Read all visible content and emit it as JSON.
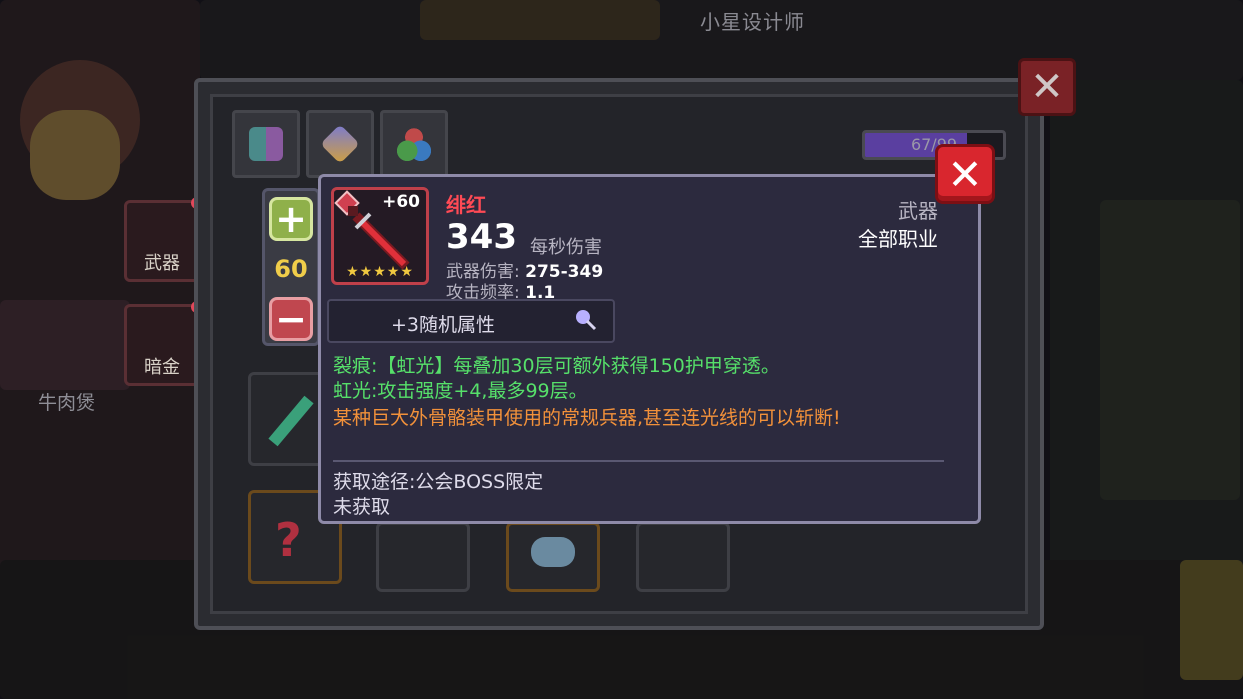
{
  "background": {
    "player_title": "小星设计师",
    "side_slot_weapon": "武器",
    "side_slot_gold": "暗金",
    "player_name": "牛肉煲"
  },
  "panel": {
    "capacity_text": "67/99",
    "close_icon": "close-icon"
  },
  "stepper": {
    "plus_icon": "plus-icon",
    "value": "60",
    "minus_icon": "minus-icon"
  },
  "item": {
    "level": "+60",
    "stars": "★★★★★",
    "name": "绯红",
    "dps_value": "343",
    "dps_label": "每秒伤害",
    "weapon_damage_label": "武器伤害:",
    "weapon_damage_value": "275-349",
    "attack_rate_label": "攻击频率:",
    "attack_rate_value": "1.1",
    "type": "武器",
    "class": "全部职业",
    "random_attr_label": "+3随机属性",
    "effect_line_1": "裂痕:【虹光】每叠加30层可额外获得150护甲穿透。",
    "effect_line_2": "虹光:攻击强度+4,最多99层。",
    "flavor_text": "某种巨大外骨骼装甲使用的常规兵器,甚至连光线的可以斩断!",
    "source": "获取途径:公会BOSS限定",
    "status": "未获取"
  },
  "colors": {
    "item_name": "#ff4a55",
    "effect": "#56e06a",
    "flavor": "#f2913a",
    "stepper_value": "#f0cd4a"
  }
}
